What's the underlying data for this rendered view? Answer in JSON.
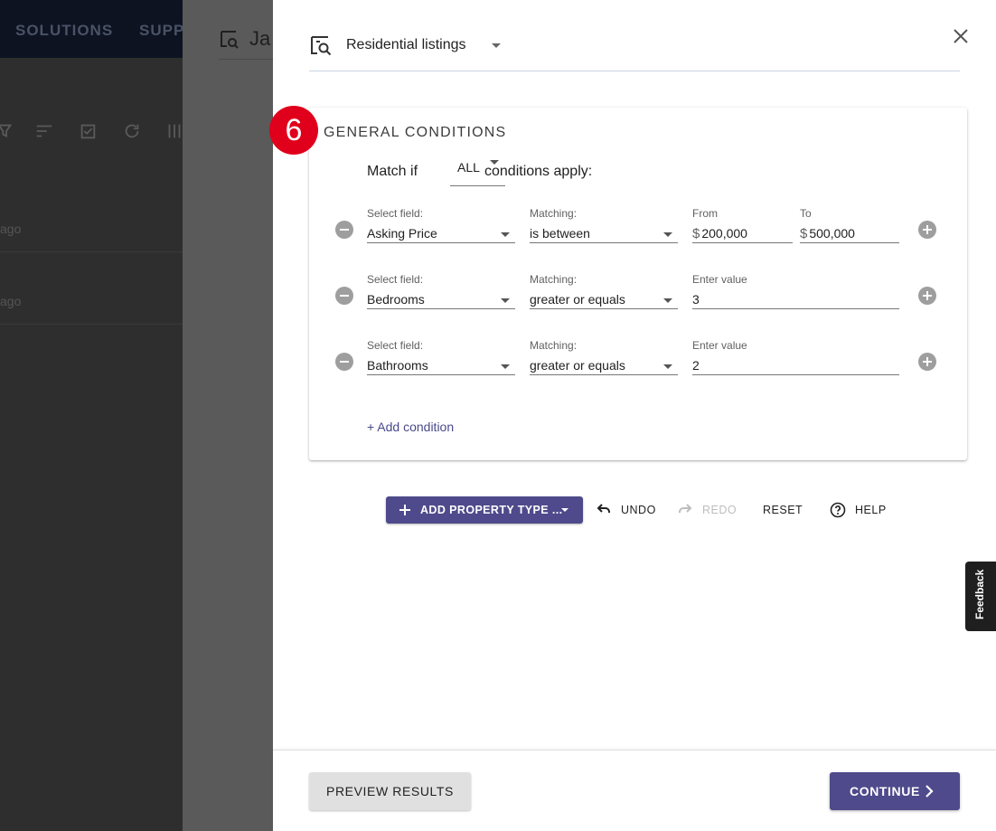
{
  "background": {
    "nav_items": [
      "SOLUTIONS",
      "SUPP"
    ],
    "strip_title": "Ja",
    "rows": [
      "ago",
      "ago"
    ]
  },
  "dialog": {
    "listing_select": "Residential listings",
    "card": {
      "step_badge": "6",
      "title": "GENERAL CONDITIONS",
      "match_prefix": "Match if",
      "match_value": "ALL",
      "match_suffix": "conditions apply:",
      "conditions": [
        {
          "field_label": "Select field:",
          "field_value": "Asking Price",
          "matching_label": "Matching:",
          "matching_value": "is between",
          "from_label": "From",
          "from_currency": "$",
          "from_value": "200,000",
          "to_label": "To",
          "to_currency": "$",
          "to_value": "500,000"
        },
        {
          "field_label": "Select field:",
          "field_value": "Bedrooms",
          "matching_label": "Matching:",
          "matching_value": "greater or equals",
          "value_label": "Enter value",
          "value": "3"
        },
        {
          "field_label": "Select field:",
          "field_value": "Bathrooms",
          "matching_label": "Matching:",
          "matching_value": "greater or equals",
          "value_label": "Enter value",
          "value": "2"
        }
      ],
      "add_condition": "+ Add condition"
    },
    "toolbar": {
      "add_property_type": "ADD PROPERTY TYPE ...",
      "undo": "UNDO",
      "redo": "REDO",
      "reset": "RESET",
      "help": "HELP"
    },
    "footer": {
      "preview": "PREVIEW RESULTS",
      "continue": "CONTINUE"
    }
  },
  "feedback_tab": "Feedback",
  "colors": {
    "accent": "#4f4a8b",
    "badge": "#e0001b",
    "link": "#4a4a8a"
  }
}
